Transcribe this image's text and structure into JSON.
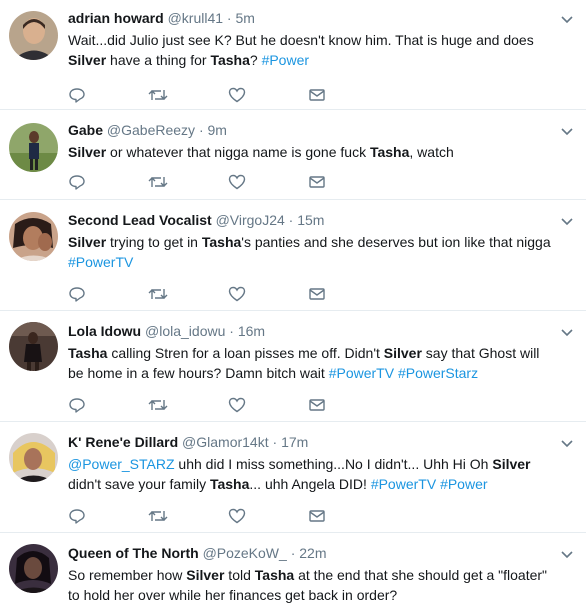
{
  "icons": {
    "reply": "reply-icon",
    "retweet": "retweet-icon",
    "like": "heart-icon",
    "message": "direct-message-icon",
    "more": "chevron-down-icon"
  },
  "colors": {
    "link": "#1b95e0",
    "secondary": "#657786",
    "divider": "#e6ecf0"
  },
  "tweets": [
    {
      "name": "adrian howard",
      "handle": "@krull41",
      "dot": "·",
      "time": "5m",
      "segments": [
        {
          "t": "Wait...did Julio just see K? But he doesn't know him. That is huge and does "
        },
        {
          "t": "Silver",
          "b": true
        },
        {
          "t": " have a thing for "
        },
        {
          "t": "Tasha",
          "b": true
        },
        {
          "t": "? "
        },
        {
          "t": "#Power",
          "tag": true
        }
      ]
    },
    {
      "name": "Gabe",
      "handle": "@GabeReezy",
      "dot": "·",
      "time": "9m",
      "segments": [
        {
          "t": "Silver",
          "b": true
        },
        {
          "t": " or whatever that nigga name is gone fuck "
        },
        {
          "t": "Tasha",
          "b": true
        },
        {
          "t": ", watch"
        }
      ]
    },
    {
      "name": "Second Lead Vocalist",
      "handle": "@VirgoJ24",
      "dot": "·",
      "time": "15m",
      "segments": [
        {
          "t": "Silver",
          "b": true
        },
        {
          "t": " trying to get in "
        },
        {
          "t": "Tasha",
          "b": true
        },
        {
          "t": "'s panties and she deserves but ion like that nigga "
        },
        {
          "t": "#PowerTV",
          "tag": true
        }
      ]
    },
    {
      "name": "Lola Idowu",
      "handle": "@lola_idowu",
      "dot": "·",
      "time": "16m",
      "segments": [
        {
          "t": "Tasha",
          "b": true
        },
        {
          "t": " calling Stren for a loan pisses me off. Didn't "
        },
        {
          "t": "Silver",
          "b": true
        },
        {
          "t": " say that Ghost will be home in a few hours? Damn bitch wait "
        },
        {
          "t": "#PowerTV",
          "tag": true
        },
        {
          "t": " "
        },
        {
          "t": "#PowerStarz",
          "tag": true
        }
      ]
    },
    {
      "name": "K' Rene'e Dillard",
      "handle": "@Glamor14kt",
      "dot": "·",
      "time": "17m",
      "segments": [
        {
          "t": "@Power_STARZ",
          "tag": true
        },
        {
          "t": " uhh did I miss something...No I didn't... Uhh Hi Oh "
        },
        {
          "t": "Silver",
          "b": true
        },
        {
          "t": " didn't save your family "
        },
        {
          "t": "Tasha",
          "b": true
        },
        {
          "t": "... uhh Angela DID! "
        },
        {
          "t": "#PowerTV",
          "tag": true
        },
        {
          "t": " "
        },
        {
          "t": "#Power",
          "tag": true
        }
      ]
    },
    {
      "name": "Queen of The North",
      "handle": "@PozeKoW_",
      "dot": "·",
      "time": "22m",
      "segments": [
        {
          "t": "So remember how "
        },
        {
          "t": "Silver",
          "b": true
        },
        {
          "t": " told "
        },
        {
          "t": "Tasha",
          "b": true
        },
        {
          "t": " at the end that she should get a \"floater\" to hold her over while her finances get back in order?"
        }
      ]
    }
  ]
}
